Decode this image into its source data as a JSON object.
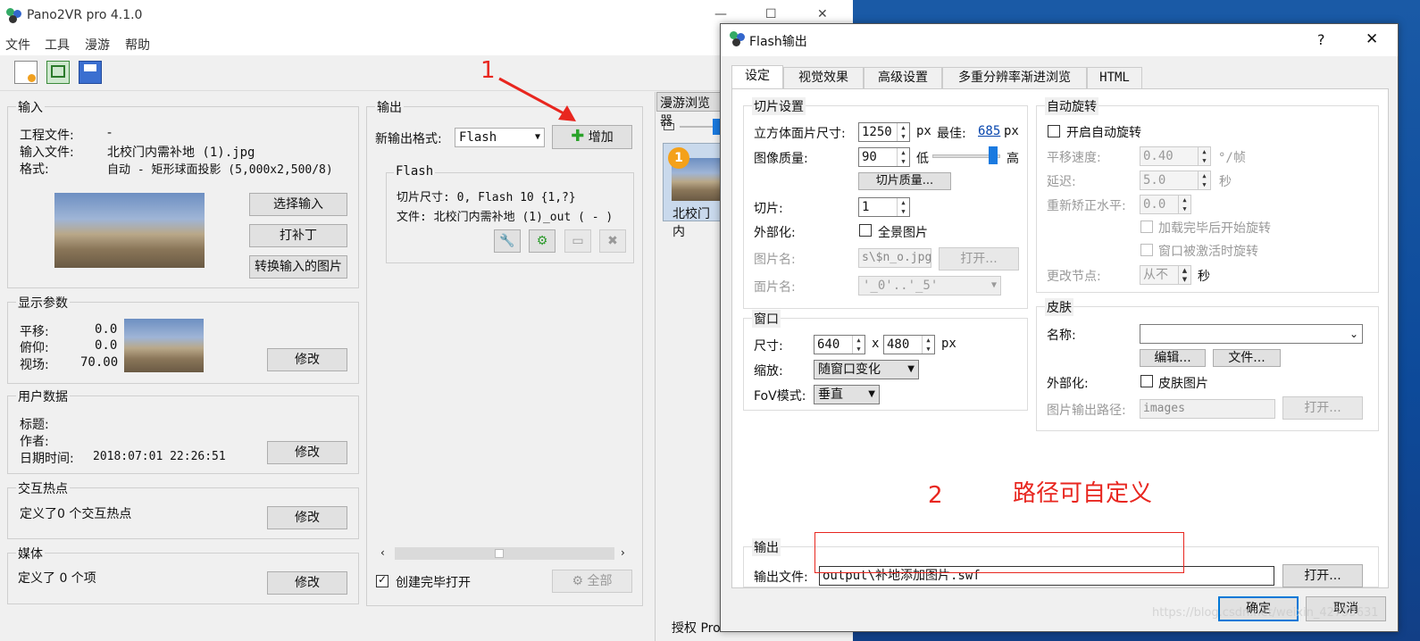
{
  "main_window": {
    "title": "Pano2VR pro 4.1.0",
    "controls": {
      "minimize": "—",
      "maximize": "☐",
      "close": "✕"
    },
    "menu": [
      "文件",
      "工具",
      "漫游",
      "帮助"
    ],
    "toolbar_icons": [
      "new-project-icon",
      "open-project-icon",
      "save-icon"
    ],
    "input_group": {
      "title": "输入",
      "project_label": "工程文件:",
      "project_value": "-",
      "input_label": "输入文件:",
      "input_value": "北校门内需补地 (1).jpg",
      "format_label": "格式:",
      "format_value": "自动 - 矩形球面投影 (5,000x2,500/8)",
      "btn_select": "选择输入",
      "btn_patch": "打补丁",
      "btn_convert": "转换输入的图片"
    },
    "display_group": {
      "title": "显示参数",
      "pan_label": "平移:",
      "pan_value": "0.0",
      "tilt_label": "俯仰:",
      "tilt_value": "0.0",
      "fov_label": "视场:",
      "fov_value": "70.00",
      "btn_modify": "修改"
    },
    "user_group": {
      "title": "用户数据",
      "title_label": "标题:",
      "author_label": "作者:",
      "date_label": "日期时间:",
      "date_value": "2018:07:01 22:26:51",
      "btn_modify": "修改"
    },
    "hotspot_group": {
      "title": "交互热点",
      "text": "定义了0 个交互热点",
      "btn_modify": "修改"
    },
    "media_group": {
      "title": "媒体",
      "text": "定义了 0 个项",
      "btn_modify": "修改"
    },
    "output_group": {
      "title": "输出",
      "new_format_label": "新输出格式:",
      "new_format_value": "Flash",
      "btn_add": "增加",
      "flash_title": "Flash",
      "tile_line": "切片尺寸: 0, Flash 10 {1,?}",
      "file_line": "文件: 北校门内需补地 (1)_out ( - )",
      "open_after_label": "创建完毕打开",
      "btn_all": "全部"
    },
    "tour_browser": {
      "title": "漫游浏览器",
      "badge": "1",
      "node_label": "北校门内",
      "bottom_text": "授权 Pro"
    }
  },
  "annotations": {
    "num1": "1",
    "num2": "2",
    "note": "路径可自定义"
  },
  "dialog": {
    "title": "Flash输出",
    "help": "?",
    "close": "✕",
    "tabs": [
      "设定",
      "视觉效果",
      "高级设置",
      "多重分辨率渐进浏览",
      "HTML"
    ],
    "tile_group": {
      "title": "切片设置",
      "cube_size_label": "立方体面片尺寸:",
      "cube_size_value": "1250",
      "px": "px",
      "best_label": "最佳:",
      "best_value": "685",
      "quality_label": "图像质量:",
      "quality_value": "90",
      "low": "低",
      "high": "高",
      "quality_slider": 0.9,
      "btn_tile_quality": "切片质量...",
      "tiles_label": "切片:",
      "tiles_value": "1",
      "external_label": "外部化:",
      "external_chk": "全景图片",
      "image_name_label": "图片名:",
      "image_name_value": "s\\$n_o.jpg",
      "btn_open": "打开...",
      "face_name_label": "面片名:",
      "face_name_value": "'_0'..'_5'"
    },
    "window_group": {
      "title": "窗口",
      "size_label": "尺寸:",
      "width_value": "640",
      "x": "x",
      "height_value": "480",
      "px": "px",
      "scale_label": "缩放:",
      "scale_value": "随窗口变化",
      "fov_mode_label": "FoV模式:",
      "fov_mode_value": "垂直"
    },
    "autorotate_group": {
      "title": "自动旋转",
      "enable_label": "开启自动旋转",
      "speed_label": "平移速度:",
      "speed_value": "0.40",
      "speed_unit": "°/帧",
      "delay_label": "延迟:",
      "delay_value": "5.0",
      "delay_unit": "秒",
      "level_label": "重新矫正水平:",
      "level_value": "0.0",
      "after_load_label": "加载完毕后开始旋转",
      "on_activate_label": "窗口被激活时旋转",
      "change_node_label": "更改节点:",
      "change_node_value": "从不",
      "change_node_unit": "秒"
    },
    "skin_group": {
      "title": "皮肤",
      "name_label": "名称:",
      "name_value": "",
      "btn_edit": "编辑...",
      "btn_file": "文件...",
      "external_label": "外部化:",
      "external_chk": "皮肤图片",
      "path_label": "图片输出路径:",
      "path_value": "images",
      "btn_open": "打开..."
    },
    "output_group": {
      "title": "输出",
      "file_label": "输出文件:",
      "file_value": "output\\补地添加图片.swf",
      "btn_open": "打开..."
    },
    "btn_ok": "确定",
    "btn_cancel": "取消"
  },
  "watermark": "https://blog.csdn.net/weixin_42753631",
  "colors": {
    "accent_red": "#e8261f",
    "link_blue": "#0645ad",
    "desktop_blue": "#0d4a9a"
  }
}
